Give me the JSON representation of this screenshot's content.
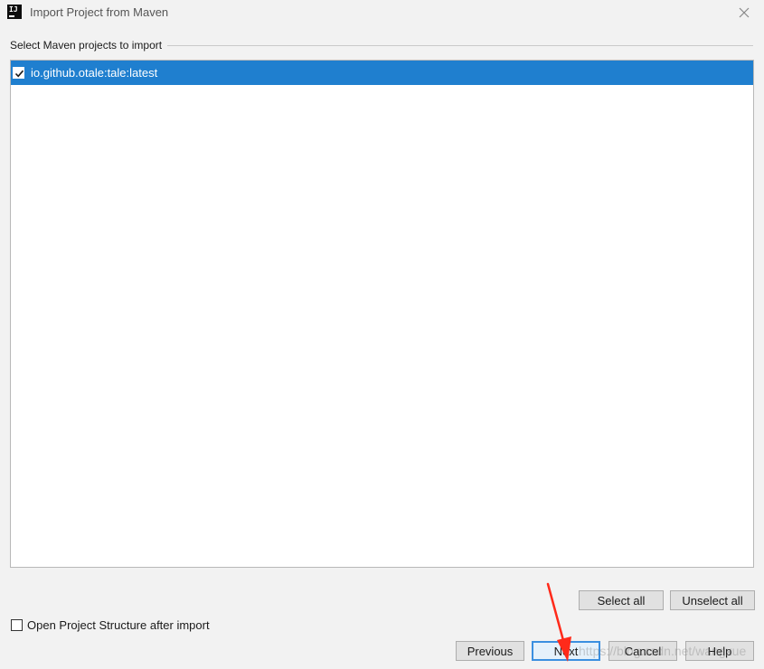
{
  "window": {
    "title": "Import Project from Maven",
    "app_icon_text": "IJ"
  },
  "section": {
    "label": "Select Maven projects to import"
  },
  "projects": [
    {
      "name": "io.github.otale:tale:latest",
      "checked": true,
      "selected": true
    }
  ],
  "list_buttons": {
    "select_all": "Select all",
    "unselect_all": "Unselect all"
  },
  "options": {
    "open_structure_label": "Open Project Structure after import"
  },
  "footer": {
    "previous": "Previous",
    "next": "Next",
    "cancel": "Cancel",
    "help": "Help"
  },
  "watermark": "https://blog.csdn.net/wangxue",
  "colors": {
    "selection": "#1f7fcf",
    "default_button_border": "#3b8fe0",
    "annotation_arrow": "#ff2a1a"
  },
  "icons": {
    "app": "intellij-logo-icon",
    "close": "close-icon",
    "check": "checkmark-icon",
    "annotation": "red-arrow-icon"
  }
}
